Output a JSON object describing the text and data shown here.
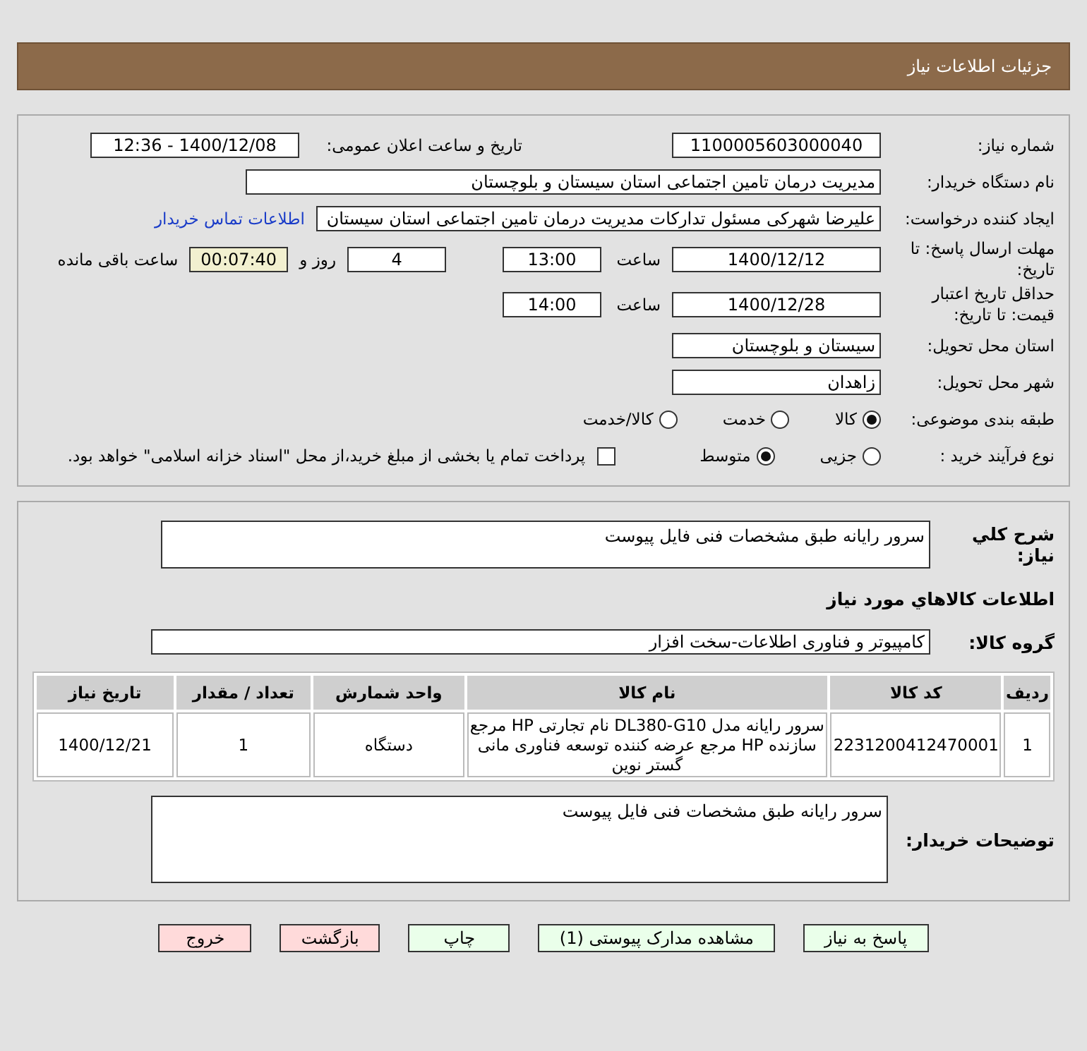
{
  "header": {
    "title": "جزئیات اطلاعات نیاز"
  },
  "need_number": {
    "label": "شماره نیاز:",
    "value": "1100005603000040"
  },
  "announce": {
    "label": "تاریخ و ساعت اعلان عمومی:",
    "value": "1400/12/08 - 12:36"
  },
  "buyer_org": {
    "label": "نام دستگاه خریدار:",
    "value": "مدیریت درمان تامین اجتماعی استان سیستان و بلوچستان"
  },
  "requester": {
    "label": "ایجاد کننده درخواست:",
    "value": "علیرضا شهرکی مسئول تدارکات مدیریت درمان تامین اجتماعی استان سیستان",
    "link": "اطلاعات تماس خریدار"
  },
  "deadline": {
    "label": "مهلت ارسال پاسخ: تا تاریخ:",
    "date": "1400/12/12",
    "time_label": "ساعت",
    "time": "13:00",
    "days": "4",
    "days_label": "روز و",
    "remaining": "00:07:40",
    "remaining_label": "ساعت باقی مانده"
  },
  "validity": {
    "label": "حداقل تاریخ اعتبار قیمت: تا تاریخ:",
    "date": "1400/12/28",
    "time_label": "ساعت",
    "time": "14:00"
  },
  "province": {
    "label": "استان محل تحویل:",
    "value": "سیستان و بلوچستان"
  },
  "city": {
    "label": "شهر محل تحویل:",
    "value": "زاهدان"
  },
  "category": {
    "label": "طبقه بندی موضوعی:",
    "options": [
      {
        "label": "کالا",
        "selected": true
      },
      {
        "label": "خدمت",
        "selected": false
      },
      {
        "label": "کالا/خدمت",
        "selected": false
      }
    ]
  },
  "process": {
    "label": "نوع فرآیند خرید :",
    "options": [
      {
        "label": "جزیی",
        "selected": false
      },
      {
        "label": "متوسط",
        "selected": true
      }
    ],
    "payment": {
      "checked": false,
      "label": "پرداخت تمام یا بخشی از مبلغ خرید،از محل \"اسناد خزانه اسلامی\" خواهد بود."
    }
  },
  "description": {
    "label": "شرح کلي نياز:",
    "value": "سرور رایانه طبق مشخصات فنی فایل پیوست"
  },
  "goods_title": "اطلاعات کالاهاي مورد نياز",
  "goods_group": {
    "label": "گروه کالا:",
    "value": "کامپیوتر و فناوری اطلاعات-سخت افزار"
  },
  "table": {
    "columns": [
      "ردیف",
      "کد کالا",
      "نام کالا",
      "واحد شمارش",
      "تعداد / مقدار",
      "تاریخ نیاز"
    ],
    "rows": [
      [
        "1",
        "2231200412470001",
        "سرور رایانه مدل DL380-G10 نام تجارتی HP مرجع سازنده HP مرجع عرضه کننده توسعه فناوری مانی گستر نوین",
        "دستگاه",
        "1",
        "1400/12/21"
      ]
    ]
  },
  "buyer_notes": {
    "label": "توضیحات خریدار:",
    "value": "سرور رایانه طبق مشخصات فنی فایل پیوست"
  },
  "buttons": [
    {
      "label": "پاسخ به نیاز",
      "kind": "action"
    },
    {
      "label": "مشاهده مدارک پیوستی (1)",
      "kind": "action"
    },
    {
      "label": "چاپ",
      "kind": "action"
    },
    {
      "label": "بازگشت",
      "kind": "exit"
    },
    {
      "label": "خروج",
      "kind": "exit"
    }
  ]
}
